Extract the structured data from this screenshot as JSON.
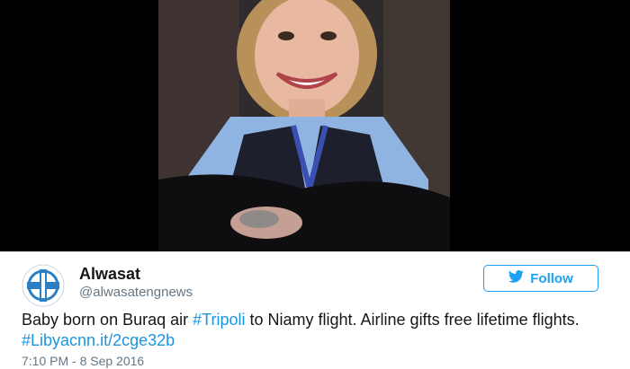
{
  "tweet": {
    "author_name": "Alwasat",
    "author_handle": "@alwasatengnews",
    "follow_label": "Follow",
    "text_segments": [
      {
        "text": "Baby born on Buraq air ",
        "type": "plain"
      },
      {
        "text": "#Tripoli",
        "type": "hashtag"
      },
      {
        "text": " to Niamy flight. Airline gifts free lifetime flights. ",
        "type": "plain"
      },
      {
        "text": "#Libyacnn.it/2cge32b",
        "type": "hashtag"
      }
    ],
    "timestamp": "7:10 PM - 8 Sep 2016"
  },
  "icons": {
    "avatar": "alwasat-logo-icon",
    "follow": "bird-icon"
  },
  "colors": {
    "accent": "#1da1f2",
    "link": "#1b95e0",
    "text": "#14171a",
    "muted": "#657786",
    "divider": "#e1e8ed"
  }
}
